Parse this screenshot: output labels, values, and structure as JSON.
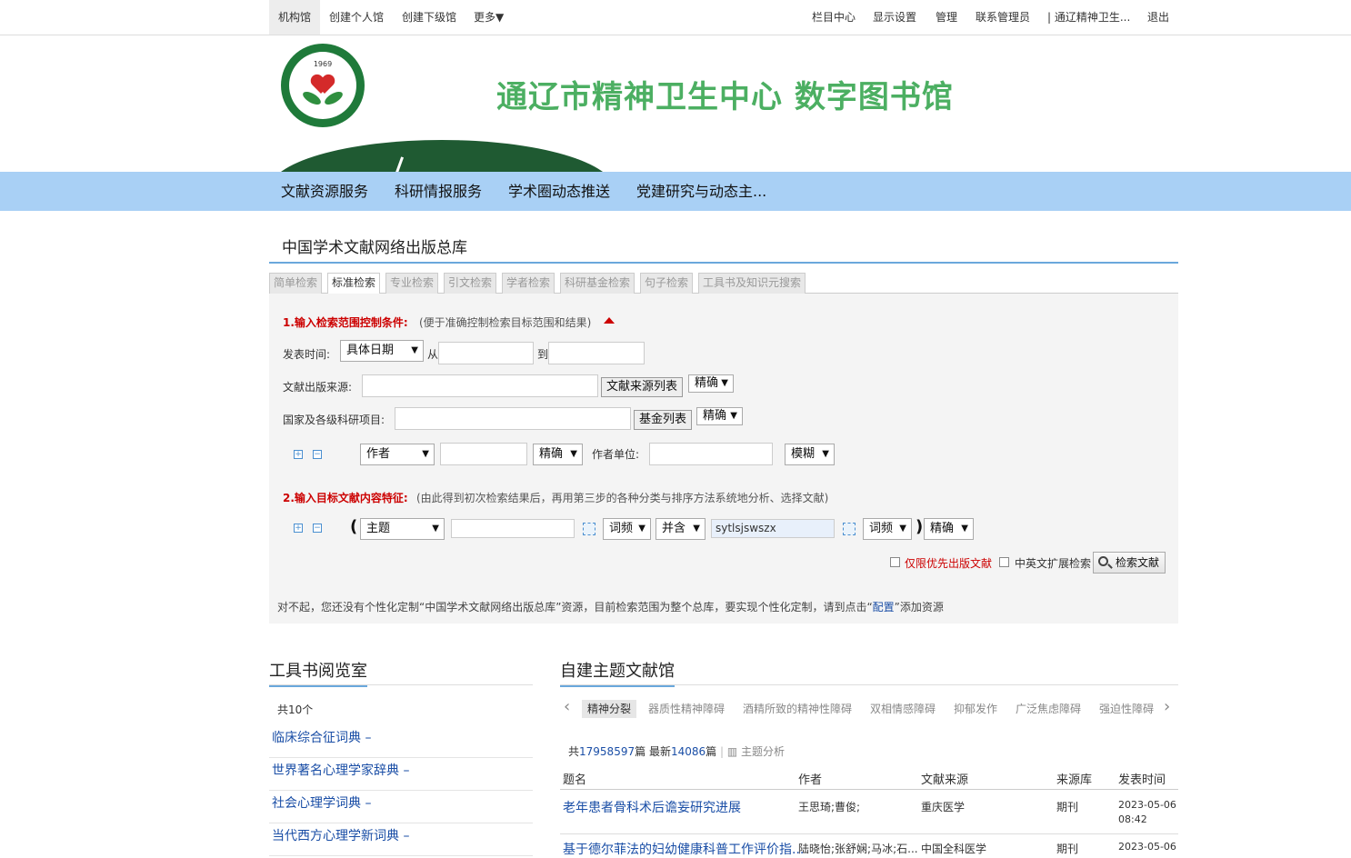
{
  "topbar": {
    "left": [
      "机构馆",
      "创建个人馆",
      "创建下级馆",
      "更多▼"
    ],
    "right": [
      "栏目中心",
      "显示设置",
      "管理",
      "联系管理员",
      "| 通辽精神卫生...",
      "退出"
    ]
  },
  "banner": {
    "title": "通辽市精神卫生中心 数字图书馆",
    "logo_year": "1969",
    "colors": {
      "title": "#4caf62",
      "hill": "#1f5a32",
      "nav_bg": "#a9d0f5"
    }
  },
  "nav": [
    "文献资源服务",
    "科研情报服务",
    "学术圈动态推送",
    "党建研究与动态主..."
  ],
  "database": {
    "title": "中国学术文献网络出版总库",
    "tabs": [
      "简单检索",
      "标准检索",
      "专业检索",
      "引文检索",
      "学者检索",
      "科研基金检索",
      "句子检索",
      "工具书及知识元搜索"
    ],
    "active_tab": "标准检索"
  },
  "search": {
    "step1": "1.输入检索范围控制条件:",
    "step1_hint": "(便于准确控制检索目标范围和结果)",
    "date_label": "发表时间:",
    "date_select": "具体日期",
    "from": "从",
    "to": "到",
    "source_label": "文献出版来源:",
    "source_btn": "文献来源列表",
    "source_match": "精确",
    "fund_label": "国家及各级科研项目:",
    "fund_btn": "基金列表",
    "fund_match": "精确",
    "author_field": "作者",
    "author_match": "精确",
    "unit_label": "作者单位:",
    "unit_match": "模糊",
    "step2": "2.输入目标文献内容特征:",
    "step2_hint": "(由此得到初次检索结果后，再用第三步的各种分类与排序方法系统地分析、选择文献)",
    "topic_field": "主题",
    "freq1": "词频",
    "logic": "并含",
    "keyword2": "sytlsjswszx",
    "freq2": "词频",
    "topic_match": "精确",
    "priority": "仅限优先出版文献",
    "cross_lang": "中英文扩展检索",
    "search_btn": "检索文献",
    "notice_a": "对不起，您还没有个性化定制“中国学术文献网络出版总库”资源，目前检索范围为整个总库，要实现个性化定制，请到点击“",
    "notice_link": "配置",
    "notice_b": "”添加资源"
  },
  "reference_room": {
    "title": "工具书阅览室",
    "count": "共10个",
    "books": [
      "临床综合征词典 –",
      "世界著名心理学家辞典 –",
      "社会心理学词典 –",
      "当代西方心理学新词典 –"
    ]
  },
  "topic_library": {
    "title": "自建主题文献馆",
    "tabs": [
      "精神分裂",
      "器质性精神障碍",
      "酒精所致的精神性障碍",
      "双相情感障碍",
      "抑郁发作",
      "广泛焦虑障碍",
      "强迫性障碍"
    ],
    "summary": {
      "total_prefix": "共",
      "total": "17958597",
      "total_unit": "篇",
      "new_prefix": "最新",
      "new": "14086",
      "new_unit": "篇",
      "analysis": "主题分析"
    },
    "columns": [
      "题名",
      "作者",
      "文献来源",
      "来源库",
      "发表时间"
    ],
    "rows": [
      {
        "title": "老年患者骨科术后谵妄研究进展",
        "author": "王思琦;曹俊;",
        "source": "重庆医学",
        "db": "期刊",
        "date": "2023-05-06",
        "time": "08:42"
      },
      {
        "title": "基于德尔菲法的妇幼健康科普工作评价指...",
        "author": "陆晓怡;张舒娴;马冰;石...",
        "source": "中国全科医学",
        "db": "期刊",
        "date": "2023-05-06",
        "time": ""
      }
    ]
  }
}
